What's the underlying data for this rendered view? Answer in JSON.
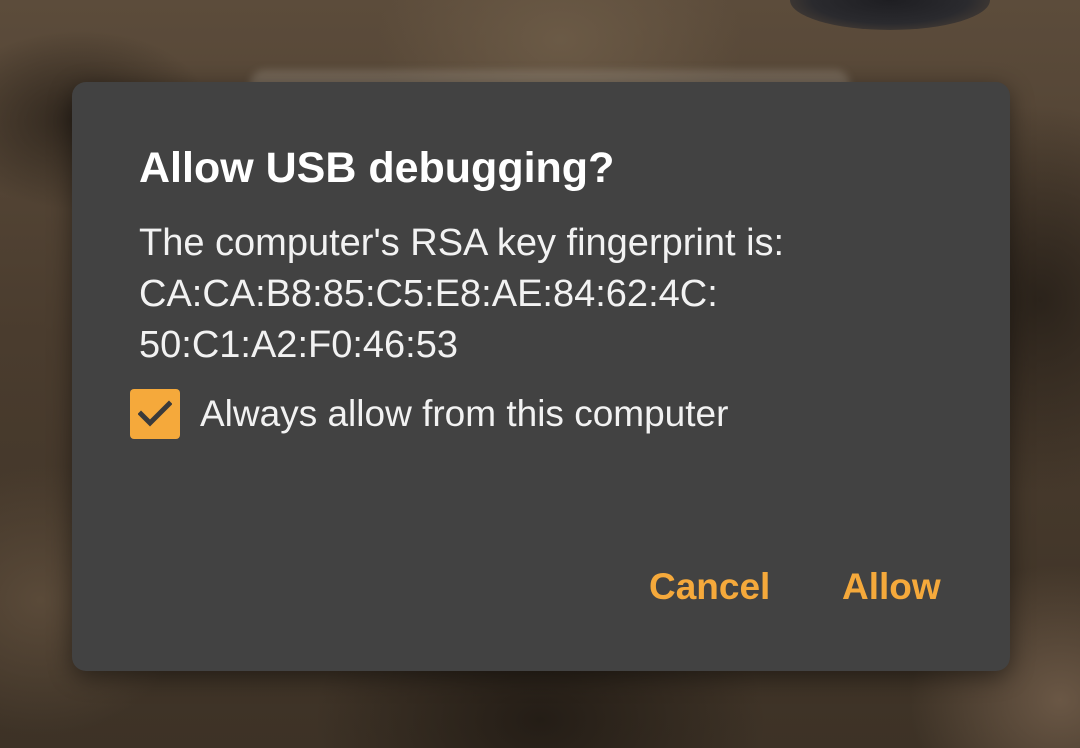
{
  "colors": {
    "dialog_background": "#424242",
    "accent": "#f5a93b",
    "title_text": "#ffffff",
    "body_text": "#f2f2f2"
  },
  "dialog": {
    "title": "Allow USB debugging?",
    "message_lines": [
      "The computer's RSA key fingerprint is:",
      "CA:CA:B8:85:C5:E8:AE:84:62:4C:",
      "50:C1:A2:F0:46:53"
    ],
    "checkbox": {
      "label": "Always allow from this computer",
      "checked": true,
      "icon": "checkmark-icon"
    },
    "buttons": {
      "cancel_label": "Cancel",
      "allow_label": "Allow"
    }
  }
}
